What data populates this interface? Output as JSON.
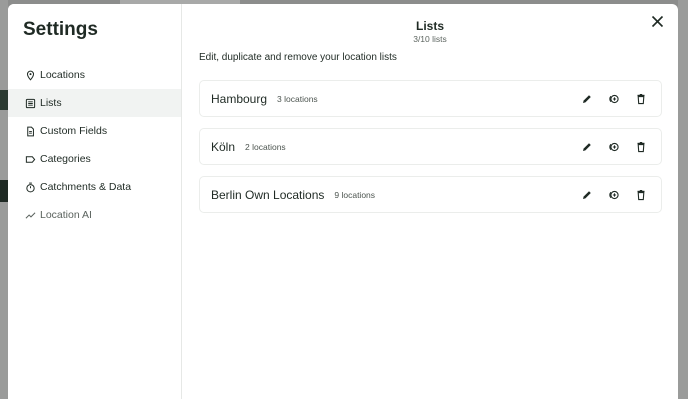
{
  "settings": {
    "title": "Settings",
    "nav": [
      {
        "label": "Locations",
        "icon": "pin-icon"
      },
      {
        "label": "Lists",
        "icon": "list-icon",
        "active": true
      },
      {
        "label": "Custom Fields",
        "icon": "document-icon"
      },
      {
        "label": "Categories",
        "icon": "tag-icon"
      },
      {
        "label": "Catchments & Data",
        "icon": "stopwatch-icon"
      },
      {
        "label": "Location AI",
        "icon": "trend-icon"
      }
    ]
  },
  "header": {
    "title": "Lists",
    "count": "3/10 lists",
    "subtitle": "Edit, duplicate and remove your location lists"
  },
  "lists": [
    {
      "name": "Hambourg",
      "count": "3 locations"
    },
    {
      "name": "Köln",
      "count": "2 locations"
    },
    {
      "name": "Berlin Own Locations",
      "count": "9 locations"
    }
  ],
  "colors": {
    "text": "#1f2a24",
    "active_bg": "#f1f3f2",
    "border": "#ebedeb"
  }
}
